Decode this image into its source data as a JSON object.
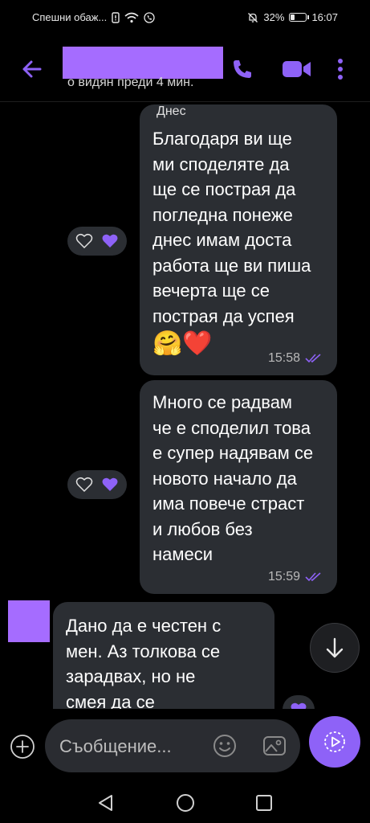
{
  "status_bar": {
    "carrier": "Спешни обаж...",
    "battery": "32%",
    "battery_level": 0.32,
    "time": "16:07"
  },
  "header": {
    "contact_status": "о видян преди 4 мин."
  },
  "chat": {
    "date_chip": "Днес",
    "messages": [
      {
        "direction": "outgoing",
        "text": "Благодаря ви ще\nми споделяте да\nще се пострая да\nпогледна понеже\nднес имам доста\nработа ще ви пиша\nвечерта ще се\nпострая да успея",
        "emojis": "🤗❤️",
        "time": "15:58"
      },
      {
        "direction": "outgoing",
        "text": "Много се радвам\nче е споделил това\nе супер надявам се\nновото начало да\nима повече страст\nи любов без\nнамеси",
        "time": "15:59"
      },
      {
        "direction": "incoming",
        "text": "Дано да е честен с\nмен. Аз толкова се\nзарадвах, но не\nсмея да се"
      }
    ]
  },
  "composer": {
    "placeholder": "Съобщение..."
  },
  "colors": {
    "accent": "#8e62f7",
    "bubble": "#2b2e33",
    "redaction": "#a56cff"
  }
}
